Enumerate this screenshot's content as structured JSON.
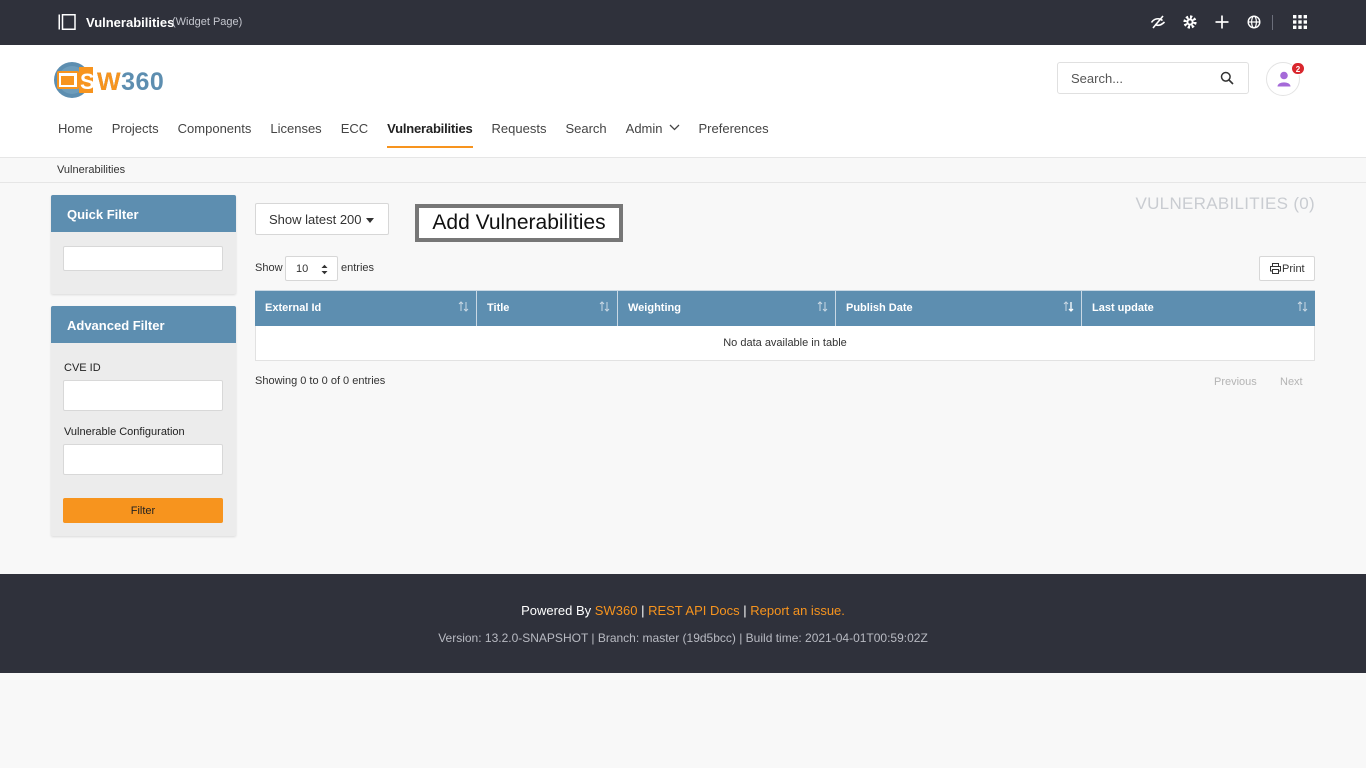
{
  "topbar": {
    "title": "Vulnerabilities",
    "subtitle": "(Widget Page)",
    "icons": [
      "sidebar-toggle-icon",
      "eye-slash-icon",
      "gear-icon",
      "plus-icon",
      "globe-icon",
      "apps-grid-icon"
    ]
  },
  "header": {
    "logo_text": "SW360",
    "search_placeholder": "Search...",
    "notification_count": "2"
  },
  "nav": {
    "items": [
      {
        "label": "Home"
      },
      {
        "label": "Projects"
      },
      {
        "label": "Components"
      },
      {
        "label": "Licenses"
      },
      {
        "label": "ECC"
      },
      {
        "label": "Vulnerabilities",
        "active": true
      },
      {
        "label": "Requests"
      },
      {
        "label": "Search"
      },
      {
        "label": "Admin",
        "has_dropdown": true
      },
      {
        "label": "Preferences"
      }
    ]
  },
  "breadcrumb": {
    "current": "Vulnerabilities"
  },
  "quick_filter": {
    "title": "Quick Filter",
    "value": ""
  },
  "advanced_filter": {
    "title": "Advanced Filter",
    "cve_label": "CVE ID",
    "config_label": "Vulnerable Configuration",
    "button_label": "Filter"
  },
  "main": {
    "show_latest_label": "Show latest 200",
    "add_button_label": "Add Vulnerabilities",
    "count_title": "VULNERABILITIES (0)",
    "show_label": "Show",
    "entries_value": "10",
    "entries_label": "entries",
    "print_label": "Print",
    "columns": [
      "External Id",
      "Title",
      "Weighting",
      "Publish Date",
      "Last update"
    ],
    "empty_message": "No data available in table",
    "info_text": "Showing 0 to 0 of 0 entries",
    "previous_label": "Previous",
    "next_label": "Next"
  },
  "footer": {
    "powered_by": "Powered By",
    "sw360_link": "SW360",
    "rest_link": "REST API Docs",
    "report_link": "Report an issue.",
    "separator": "|",
    "version_text": "Version: 13.2.0-SNAPSHOT | Branch: master (19d5bcc) | Build time: 2021-04-01T00:59:02Z"
  },
  "colors": {
    "accent": "#f7941e",
    "header_dark": "#2f313b",
    "table_header": "#5d8eb0"
  }
}
